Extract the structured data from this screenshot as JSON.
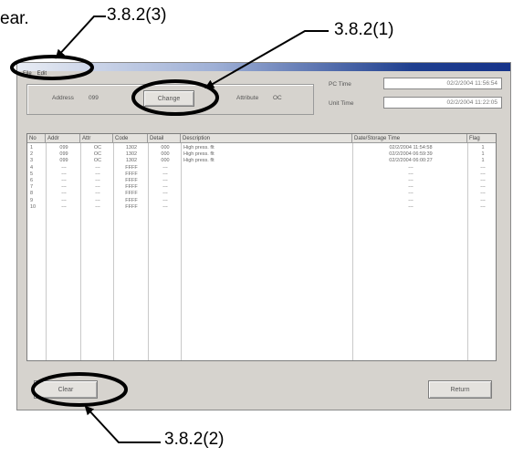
{
  "callouts": {
    "top_left_fragment": "ear.",
    "label_1": "3.8.2(1)",
    "label_2": "3.8.2(2)",
    "label_3": "3.8.2(3)"
  },
  "window": {
    "menu": [
      "File",
      "Edit"
    ],
    "address_label": "Address",
    "address_value": "099",
    "change_button": "Change",
    "attribute_label": "Attribute",
    "attribute_value": "OC",
    "pc_time_label": "PC Time",
    "pc_time_value": "02/2/2004 11:56:54",
    "unit_time_label": "Unit Time",
    "unit_time_value": "02/2/2004 11:22:05",
    "clear_button": "Clear",
    "return_button": "Return"
  },
  "table": {
    "columns": [
      "No",
      "Addr",
      "Attr",
      "Code",
      "Detail",
      "Description",
      "Date/Storage Time",
      "Flag"
    ],
    "rows": [
      [
        "1",
        "099",
        "OC",
        "1302",
        "000",
        "High press. flt",
        "02/2/2004 11:54:58",
        "1"
      ],
      [
        "2",
        "099",
        "OC",
        "1302",
        "000",
        "High press. flt",
        "02/2/2004 06:59:39",
        "1"
      ],
      [
        "3",
        "099",
        "OC",
        "1302",
        "000",
        "High press. flt",
        "02/2/2004 06:00:27",
        "1"
      ],
      [
        "4",
        "---",
        "---",
        "FFFF",
        "---",
        "",
        "---",
        "---"
      ],
      [
        "5",
        "---",
        "---",
        "FFFF",
        "---",
        "",
        "---",
        "---"
      ],
      [
        "6",
        "---",
        "---",
        "FFFF",
        "---",
        "",
        "---",
        "---"
      ],
      [
        "7",
        "---",
        "---",
        "FFFF",
        "---",
        "",
        "---",
        "---"
      ],
      [
        "8",
        "---",
        "---",
        "FFFF",
        "---",
        "",
        "---",
        "---"
      ],
      [
        "9",
        "---",
        "---",
        "FFFF",
        "---",
        "",
        "---",
        "---"
      ],
      [
        "10",
        "---",
        "---",
        "FFFF",
        "---",
        "",
        "---",
        "---"
      ]
    ]
  }
}
